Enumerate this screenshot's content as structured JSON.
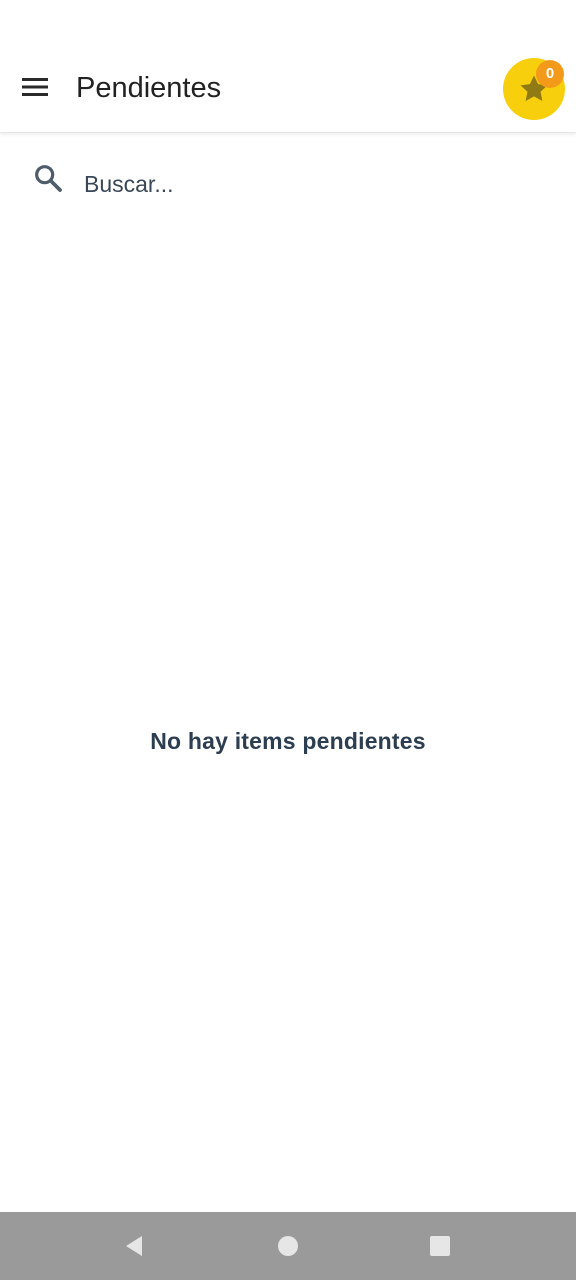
{
  "app_bar": {
    "title": "Pendientes",
    "menu_icon": "hamburger-menu-icon",
    "star_icon": "star-icon",
    "star_count": "0",
    "star_color": "#f7cf0c",
    "badge_color": "#f39a1a"
  },
  "search": {
    "icon": "search-icon",
    "placeholder": "Buscar..."
  },
  "main": {
    "empty_message": "No hay items pendientes"
  },
  "nav_bar": {
    "back_icon": "back-triangle-icon",
    "home_icon": "home-circle-icon",
    "recents_icon": "recents-square-icon"
  }
}
